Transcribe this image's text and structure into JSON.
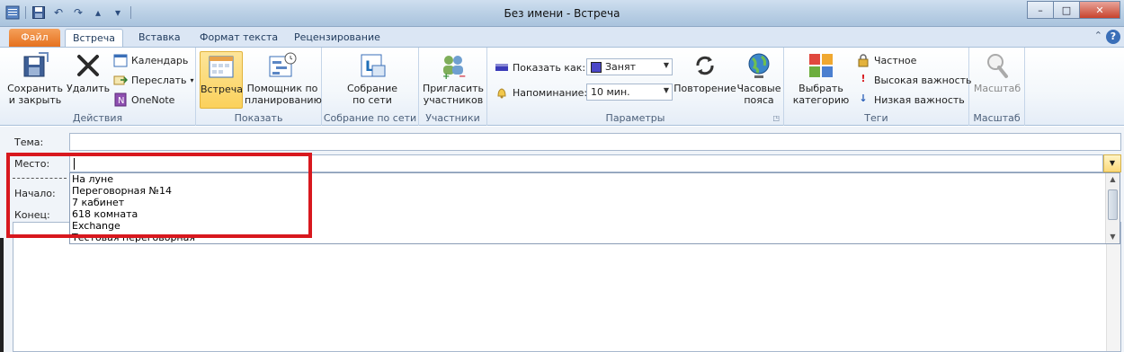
{
  "window": {
    "title": "Без имени - Встреча",
    "controls": {
      "minimize": "–",
      "maximize": "□",
      "close": "✕"
    }
  },
  "qat": {
    "icons": [
      "save-icon",
      "undo-icon",
      "redo-icon",
      "up-icon",
      "down-icon",
      "customize-icon"
    ]
  },
  "tabs": [
    {
      "label": "Файл"
    },
    {
      "label": "Встреча"
    },
    {
      "label": "Вставка"
    },
    {
      "label": "Формат текста"
    },
    {
      "label": "Рецензирование"
    }
  ],
  "ribbon": {
    "actions": {
      "label": "Действия",
      "save_close": "Сохранить и закрыть",
      "delete": "Удалить",
      "calendar": "Календарь",
      "forward": "Переслать",
      "onenote": "OneNote"
    },
    "show": {
      "label": "Показать",
      "meeting": "Встреча",
      "scheduling": "Помощник по планированию"
    },
    "online": {
      "label": "Собрание по сети",
      "meeting": "Собрание по сети"
    },
    "attendees": {
      "label": "Участники",
      "invite": "Пригласить участников"
    },
    "options": {
      "label": "Параметры",
      "show_as_label": "Показать как:",
      "show_as_value": "Занят",
      "reminder_label": "Напоминание:",
      "reminder_value": "10 мин.",
      "recurrence": "Повторение",
      "timezones": "Часовые пояса"
    },
    "tags": {
      "label": "Теги",
      "categorize": "Выбрать категорию",
      "private": "Частное",
      "high": "Высокая важность",
      "low": "Низкая важность"
    },
    "zoom": {
      "label": "Масштаб",
      "zoom": "Масштаб"
    }
  },
  "form": {
    "subject_label": "Тема:",
    "location_label": "Место:",
    "start_label": "Начало:",
    "end_label": "Конец:",
    "location_value": "",
    "location_options": [
      "На луне",
      "Переговорная №14",
      "7 кабинет",
      "618 комната",
      "Exchange",
      "Тестовая переговорная"
    ]
  },
  "colors": {
    "file_tab": "#e5711f",
    "highlight": "#d8181e",
    "ribbon_border": "#a8bfd9"
  }
}
